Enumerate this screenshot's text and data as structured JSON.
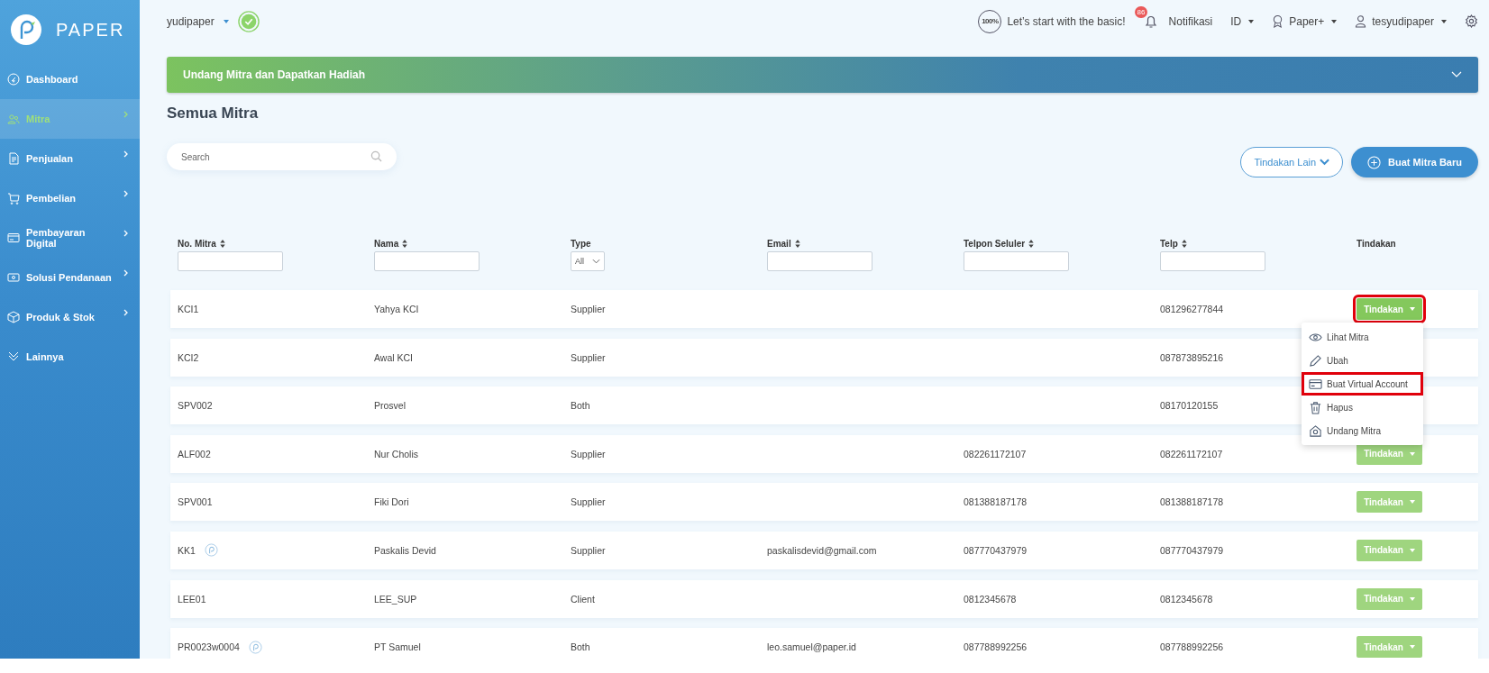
{
  "sidebar": {
    "brand": "PAPER",
    "items": [
      {
        "label": "Dashboard",
        "selected": false,
        "has_submenu": false
      },
      {
        "label": "Mitra",
        "selected": true,
        "has_submenu": true
      },
      {
        "label": "Penjualan",
        "selected": false,
        "has_submenu": true
      },
      {
        "label": "Pembelian",
        "selected": false,
        "has_submenu": true
      },
      {
        "label": "Pembayaran Digital",
        "selected": false,
        "has_submenu": true
      },
      {
        "label": "Solusi Pendanaan",
        "selected": false,
        "has_submenu": true
      },
      {
        "label": "Produk & Stok",
        "selected": false,
        "has_submenu": true
      },
      {
        "label": "Lainnya",
        "selected": false,
        "has_submenu": false
      }
    ]
  },
  "topbar": {
    "company": "yudipaper",
    "progress_badge": "100%",
    "onboarding": "Let’s start with the basic!",
    "notification_count": "86",
    "notifications": "Notifikasi",
    "language": "ID",
    "plan": "Paper+",
    "user": "tesyudipaper"
  },
  "banner": {
    "title": "Undang Mitra dan Dapatkan Hadiah",
    "expanded": false
  },
  "page_title": "Semua Mitra",
  "search": {
    "placeholder": "Search"
  },
  "buttons": {
    "more_actions": "Tindakan Lain",
    "create": "Buat Mitra Baru"
  },
  "table": {
    "columns": [
      {
        "label": "No. Mitra",
        "sortable": true,
        "kind": "text"
      },
      {
        "label": "Nama",
        "sortable": true,
        "kind": "text"
      },
      {
        "label": "Type",
        "sortable": false,
        "kind": "select",
        "filter_value": "All"
      },
      {
        "label": "Email",
        "sortable": true,
        "kind": "text"
      },
      {
        "label": "Telpon Seluler",
        "sortable": true,
        "kind": "text"
      },
      {
        "label": "Telp",
        "sortable": true,
        "kind": "text"
      },
      {
        "label": "Tindakan",
        "sortable": false
      }
    ],
    "rows": [
      {
        "no": "KCI1",
        "verified": false,
        "name": "Yahya KCI",
        "type": "Supplier",
        "phone": "081296277844",
        "action": {
          "label": "Tindakan",
          "open": true,
          "highlighted": true
        }
      },
      {
        "no": "KCI2",
        "verified": false,
        "name": "Awal KCI",
        "type": "Supplier",
        "phone": "087873895216"
      },
      {
        "no": "SPV002",
        "verified": false,
        "name": "Prosvel",
        "type": "Both",
        "phone": "08170120155"
      },
      {
        "no": "ALF002",
        "verified": false,
        "name": "Nur Cholis",
        "type": "Supplier",
        "mobile": "082261172107",
        "phone": "082261172107",
        "action": {
          "label": "Tindakan",
          "open": false,
          "highlighted": false
        }
      },
      {
        "no": "SPV001",
        "verified": false,
        "name": "Fiki Dori",
        "type": "Supplier",
        "mobile": "081388187178",
        "phone": "081388187178",
        "action": {
          "label": "Tindakan",
          "open": false,
          "highlighted": false
        }
      },
      {
        "no": "KK1",
        "verified": true,
        "name": "Paskalis Devid",
        "type": "Supplier",
        "email": "paskalisdevid@gmail.com",
        "mobile": "087770437979",
        "phone": "087770437979",
        "action": {
          "label": "Tindakan",
          "open": false,
          "highlighted": false
        }
      },
      {
        "no": "LEE01",
        "verified": false,
        "name": "LEE_SUP",
        "type": "Client",
        "mobile": "0812345678",
        "phone": "0812345678",
        "action": {
          "label": "Tindakan",
          "open": false,
          "highlighted": false
        }
      },
      {
        "no": "PR0023w0004",
        "verified": true,
        "name": "PT Samuel",
        "type": "Both",
        "email": "leo.samuel@paper.id",
        "mobile": "087788992256",
        "phone": "087788992256",
        "action": {
          "label": "Tindakan",
          "open": false,
          "highlighted": false
        }
      }
    ]
  },
  "action_menu": {
    "items": [
      {
        "label": "Lihat Mitra",
        "highlighted": false
      },
      {
        "label": "Ubah",
        "highlighted": false
      },
      {
        "label": "Buat Virtual Account",
        "highlighted": true
      },
      {
        "label": "Hapus",
        "highlighted": false
      },
      {
        "label": "Undang Mitra",
        "highlighted": false
      }
    ]
  }
}
